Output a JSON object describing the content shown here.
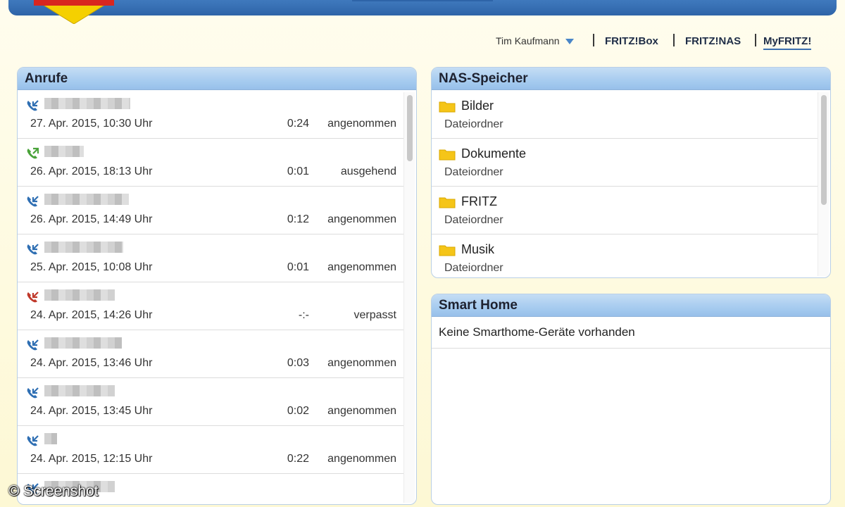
{
  "header": {
    "user_name": "Tim Kaufmann",
    "nav": [
      {
        "label": "FRITZ!Box",
        "active": false
      },
      {
        "label": "FRITZ!NAS",
        "active": false
      },
      {
        "label": "MyFRITZ!",
        "active": true
      }
    ]
  },
  "calls": {
    "title": "Anrufe",
    "rows": [
      {
        "date": "27. Apr. 2015, 10:30 Uhr",
        "duration": "0:24",
        "status": "angenommen",
        "icon": "incoming-call-icon",
        "color": "#2f6fb3"
      },
      {
        "date": "26. Apr. 2015, 18:13 Uhr",
        "duration": "0:01",
        "status": "ausgehend",
        "icon": "outgoing-call-icon",
        "color": "#4aa33a"
      },
      {
        "date": "26. Apr. 2015, 14:49 Uhr",
        "duration": "0:12",
        "status": "angenommen",
        "icon": "incoming-call-icon",
        "color": "#2f6fb3"
      },
      {
        "date": "25. Apr. 2015, 10:08 Uhr",
        "duration": "0:01",
        "status": "angenommen",
        "icon": "incoming-call-icon",
        "color": "#2f6fb3"
      },
      {
        "date": "24. Apr. 2015, 14:26 Uhr",
        "duration": "-:-",
        "status": "verpasst",
        "icon": "missed-call-icon",
        "color": "#c0392b"
      },
      {
        "date": "24. Apr. 2015, 13:46 Uhr",
        "duration": "0:03",
        "status": "angenommen",
        "icon": "incoming-call-icon",
        "color": "#2f6fb3"
      },
      {
        "date": "24. Apr. 2015, 13:45 Uhr",
        "duration": "0:02",
        "status": "angenommen",
        "icon": "incoming-call-icon",
        "color": "#2f6fb3"
      },
      {
        "date": "24. Apr. 2015, 12:15 Uhr",
        "duration": "0:22",
        "status": "angenommen",
        "icon": "incoming-call-icon",
        "color": "#2f6fb3"
      },
      {
        "date": "",
        "duration": "",
        "status": "",
        "icon": "incoming-call-icon",
        "color": "#2f6fb3"
      }
    ]
  },
  "nas": {
    "title": "NAS-Speicher",
    "items": [
      {
        "name": "Bilder",
        "type": "Dateiordner"
      },
      {
        "name": "Dokumente",
        "type": "Dateiordner"
      },
      {
        "name": "FRITZ",
        "type": "Dateiordner"
      },
      {
        "name": "Musik",
        "type": "Dateiordner"
      }
    ],
    "folder_color": "#f5c518"
  },
  "smarthome": {
    "title": "Smart Home",
    "message": "Keine Smarthome-Geräte vorhanden"
  },
  "watermark": "© Screenshot"
}
